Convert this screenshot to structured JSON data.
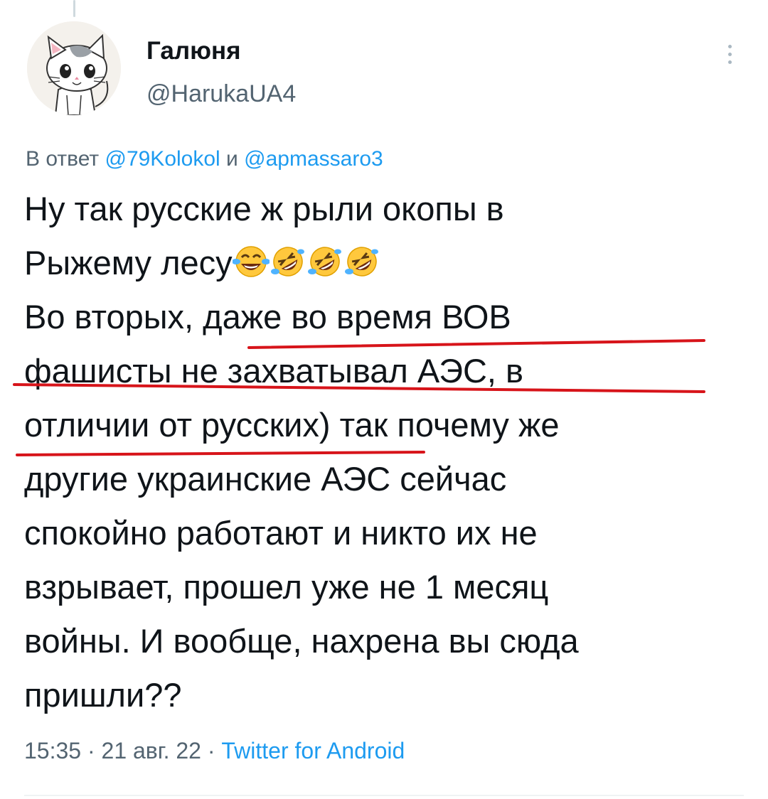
{
  "author": {
    "name": "Галюня",
    "handle": "@HarukaUA4",
    "avatar_icon": "cartoon-cat-avatar"
  },
  "reply": {
    "prefix": "В ответ",
    "mention_1": "@79Kolokol",
    "conjunction": "и",
    "mention_2": "@apmassaro3"
  },
  "tweet": {
    "lines": [
      "Ну так русские ж рыли окопы в",
      "Рыжему лесу",
      "Во вторых, даже во время ВОВ",
      "фашисты не захватывал АЭС, в",
      "отличии от русских) так почему же",
      "другие украинские АЭС сейчас",
      "спокойно работают и никто их не",
      "взрывает, прошел уже не 1 месяц",
      "войны. И вообще, нахрена вы сюда",
      "пришли??"
    ],
    "emojis": [
      "face-with-tears-of-joy",
      "rolling-on-floor-laughing",
      "rolling-on-floor-laughing",
      "rolling-on-floor-laughing"
    ]
  },
  "meta": {
    "time": "15:35",
    "date": "21 авг. 22",
    "separator": "·",
    "source": "Twitter for Android"
  },
  "colors": {
    "text": "#0f1419",
    "secondary": "#536471",
    "link": "#1d9bf0",
    "annotation_red": "#d7141a"
  }
}
